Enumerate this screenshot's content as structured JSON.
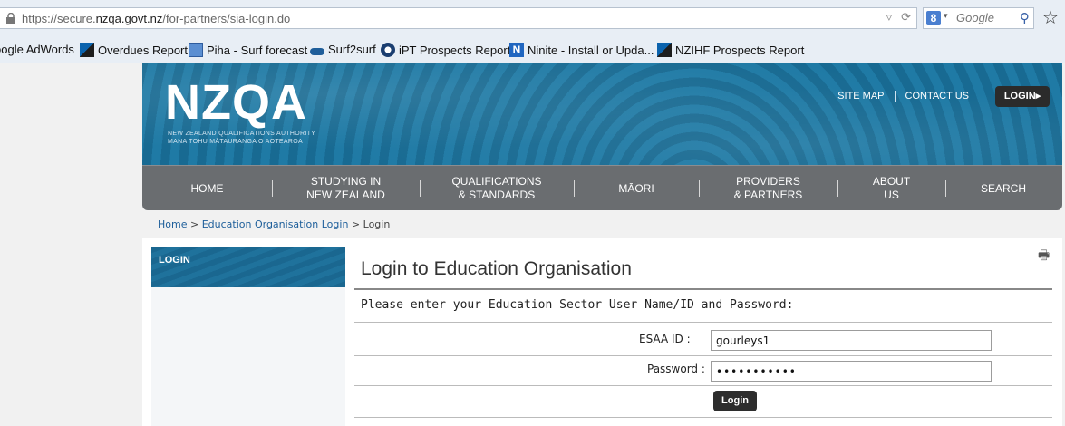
{
  "browser": {
    "url_prefix": "https://secure.",
    "url_domain": "nzqa.govt.nz",
    "url_path": "/for-partners/sia-login.do",
    "search_placeholder": "Google",
    "bookmarks": [
      {
        "label": "oogle AdWords",
        "icon": "none"
      },
      {
        "label": "Overdues Report",
        "icon": "nz-icon"
      },
      {
        "label": "Piha - Surf forecast",
        "icon": "picture-icon"
      },
      {
        "label": "Surf2surf",
        "icon": "wave-icon"
      },
      {
        "label": "iPT Prospects Report",
        "icon": "ipt-icon"
      },
      {
        "label": "Ninite - Install or Upda...",
        "icon": "ninite-icon"
      },
      {
        "label": "NZIHF Prospects Report",
        "icon": "nz-icon"
      }
    ]
  },
  "header": {
    "logo_text": "NZQA",
    "logo_subtitle_1": "NEW ZEALAND QUALIFICATIONS AUTHORITY",
    "logo_subtitle_2": "MANA TOHU MĀTAURANGA O AOTEAROA",
    "links": [
      "SITE MAP",
      "CONTACT US"
    ],
    "login_label": "LOGIN▸"
  },
  "nav": {
    "items": [
      "HOME",
      "STUDYING IN\nNEW ZEALAND",
      "QUALIFICATIONS\n& STANDARDS",
      "MĀORI",
      "PROVIDERS\n& PARTNERS",
      "ABOUT\nUS",
      "SEARCH"
    ]
  },
  "breadcrumb": {
    "home": "Home",
    "sep": " > ",
    "org_login": "Education Organisation Login",
    "current": "Login"
  },
  "sidebar": {
    "heading": "LOGIN"
  },
  "main": {
    "title": "Login to Education Organisation",
    "instructions": "Please enter your Education Sector User Name/ID and Password:",
    "esaa_label": "ESAA ID :",
    "esaa_value": "gourleys1",
    "password_label": "Password :",
    "password_value": "•••••••••••",
    "submit_label": "Login"
  }
}
